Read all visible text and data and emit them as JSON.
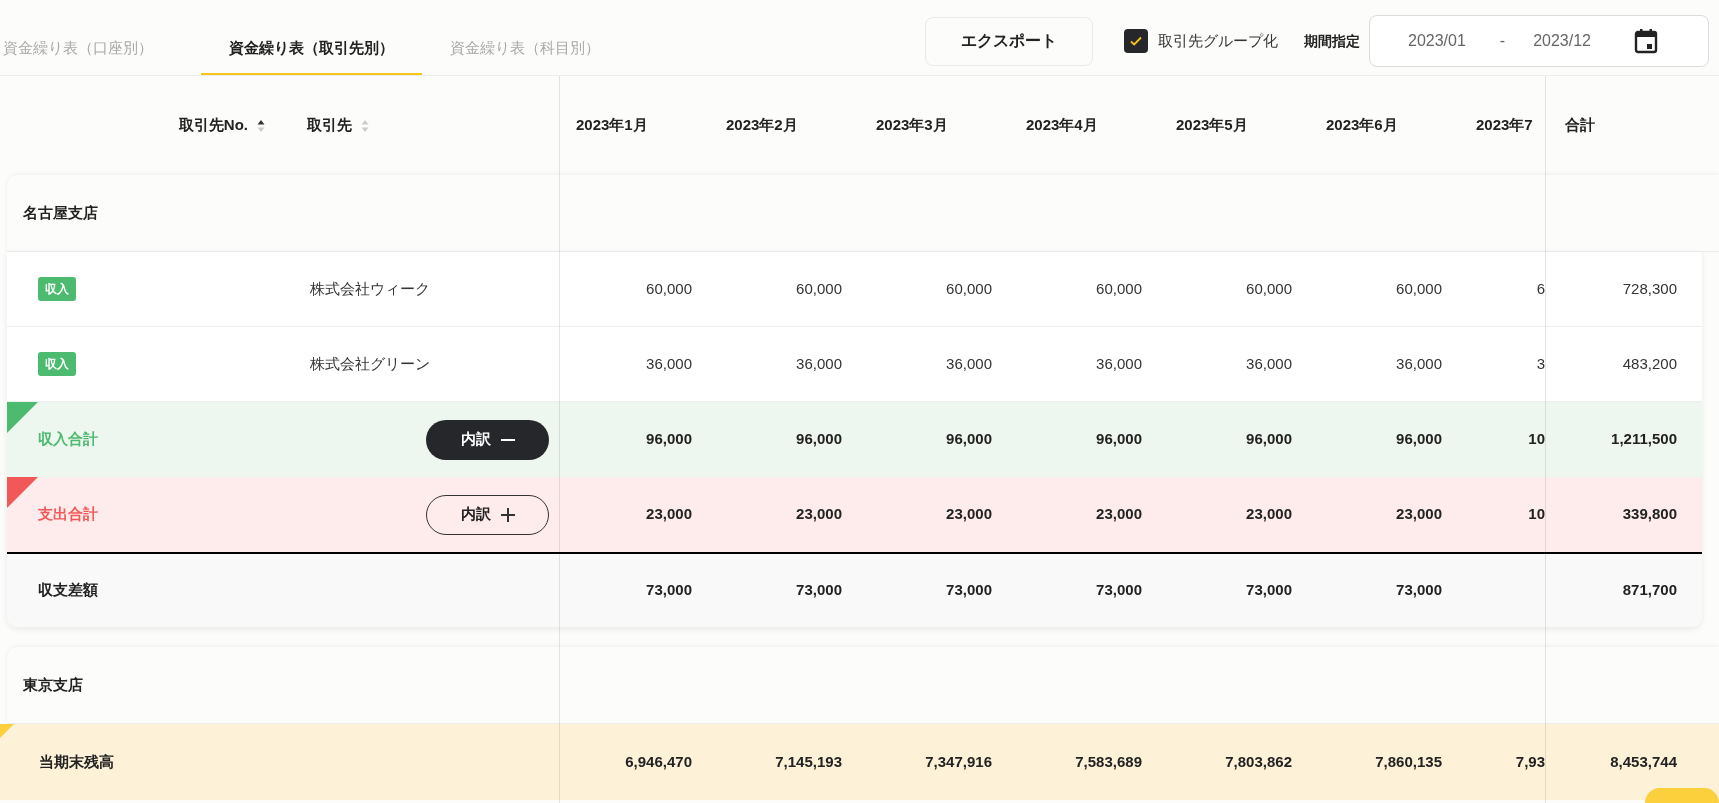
{
  "tabs": [
    {
      "label": "資金繰り表（口座別）",
      "selected": false
    },
    {
      "label": "資金繰り表（取引先別）",
      "selected": true
    },
    {
      "label": "資金繰り表（科目別）",
      "selected": false
    }
  ],
  "export_button": "エクスポート",
  "group_by_partner": {
    "label": "取引先グループ化",
    "checked": true
  },
  "period": {
    "label": "期間指定",
    "start": "2023/01",
    "separator": "-",
    "end": "2023/12"
  },
  "table": {
    "columns": [
      {
        "label": "取引先No.",
        "sorted": true
      },
      {
        "label": "取引先",
        "sorted": false
      }
    ],
    "months": [
      "2023年1月",
      "2023年2月",
      "2023年3月",
      "2023年4月",
      "2023年5月",
      "2023年6月",
      "2023年7"
    ],
    "total_label": "合計",
    "groups": [
      {
        "name": "名古屋支店",
        "rows": [
          {
            "kind": "entry",
            "badge": "収入",
            "partner": "株式会社ウィーク",
            "values": [
              "60,000",
              "60,000",
              "60,000",
              "60,000",
              "60,000",
              "60,000",
              "6"
            ],
            "total": "728,300"
          },
          {
            "kind": "entry",
            "badge": "収入",
            "partner": "株式会社グリーン",
            "values": [
              "36,000",
              "36,000",
              "36,000",
              "36,000",
              "36,000",
              "36,000",
              "3"
            ],
            "total": "483,200"
          },
          {
            "kind": "income_total",
            "label": "収入合計",
            "button": "内訳",
            "expanded": true,
            "values": [
              "96,000",
              "96,000",
              "96,000",
              "96,000",
              "96,000",
              "96,000",
              "10"
            ],
            "total": "1,211,500"
          },
          {
            "kind": "expense_total",
            "label": "支出合計",
            "button": "内訳",
            "expanded": false,
            "values": [
              "23,000",
              "23,000",
              "23,000",
              "23,000",
              "23,000",
              "23,000",
              "10"
            ],
            "total": "339,800"
          },
          {
            "kind": "difference",
            "label": "収支差額",
            "values": [
              "73,000",
              "73,000",
              "73,000",
              "73,000",
              "73,000",
              "73,000"
            ],
            "total": "871,700"
          }
        ]
      },
      {
        "name": "東京支店"
      }
    ],
    "closing_balance": {
      "label": "当期末残高",
      "values": [
        "6,946,470",
        "7,145,193",
        "7,347,916",
        "7,583,689",
        "7,803,862",
        "7,860,135",
        "7,93"
      ],
      "total": "8,453,744"
    }
  }
}
